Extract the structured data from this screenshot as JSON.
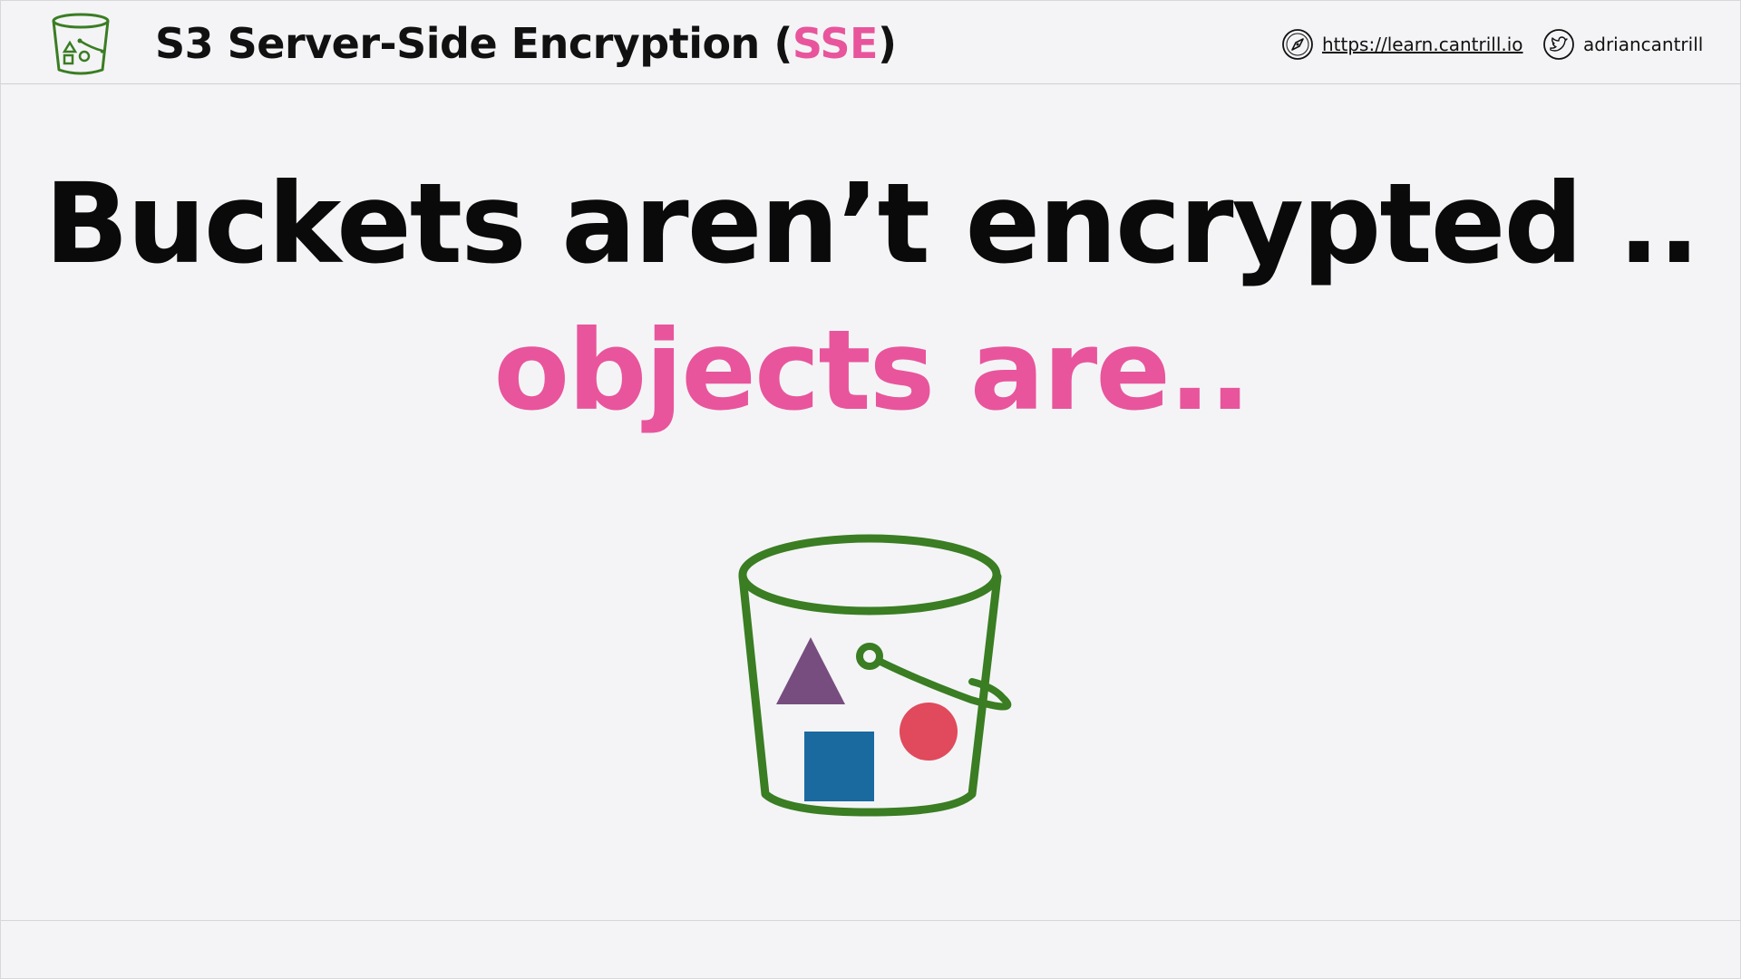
{
  "header": {
    "title_main": "S3 Server-Side Encryption (",
    "title_accent": "SSE",
    "title_close": ")",
    "link_learn_label": "https://learn.cantrill.io",
    "link_twitter_label": "adriancantrill",
    "logo_icon": "s3-bucket-icon",
    "learn_icon": "compass-icon",
    "twitter_icon": "twitter-icon"
  },
  "main": {
    "line1": "Buckets aren’t encrypted ..",
    "line2": "objects are..",
    "illustration": "s3-bucket-icon"
  },
  "colors": {
    "accent_pink": "#e8559c",
    "bucket_green": "#3a7d23",
    "triangle_purple": "#774d80",
    "square_blue": "#1a6aa0",
    "circle_red": "#e04a5c",
    "background": "#f4f4f6"
  }
}
